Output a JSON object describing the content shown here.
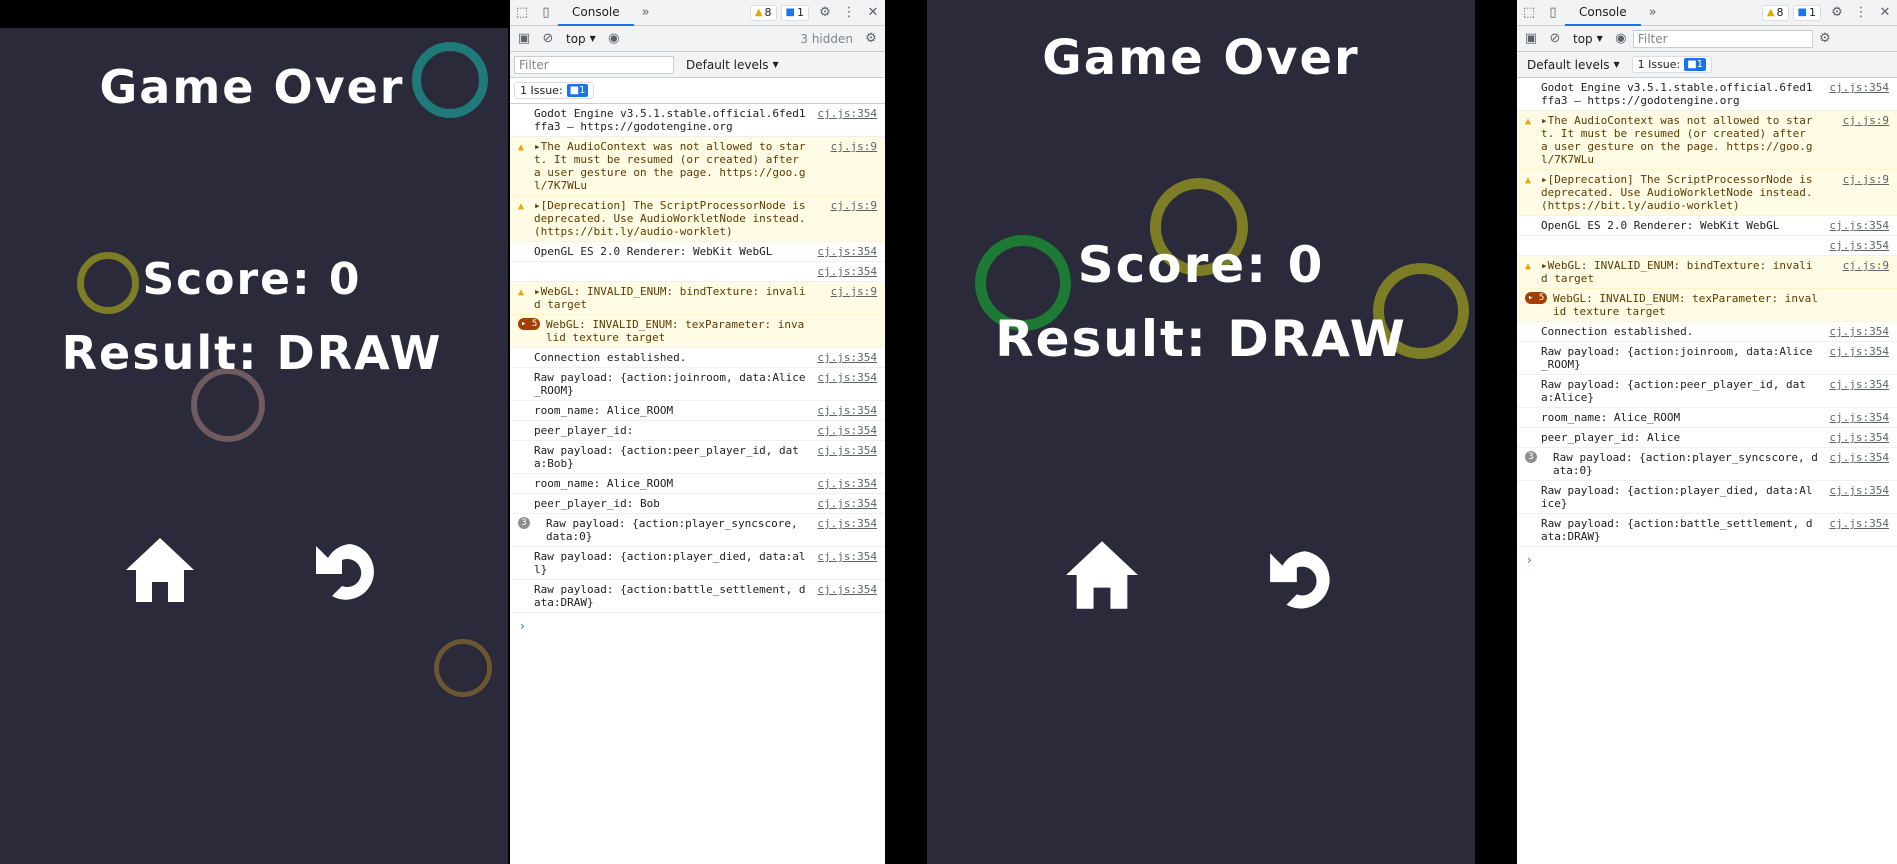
{
  "game_left": {
    "title": "Game Over",
    "score": "Score: 0",
    "result": "Result: DRAW",
    "home_icon": "home-icon",
    "restart_icon": "restart-icon"
  },
  "game_right": {
    "title": "Game Over",
    "score": "Score: 0",
    "result": "Result: DRAW",
    "home_icon": "home-icon",
    "restart_icon": "restart-icon"
  },
  "colors": {
    "game_bg": "#2b2a3a",
    "ring_teal": "#1f7a7a",
    "ring_olive": "#7c7d24",
    "ring_green": "#1c7a34",
    "ring_mauve": "#6e5a5f",
    "ring_brown": "#6b5532"
  },
  "devtools_left": {
    "tab": "Console",
    "warnings": "8",
    "messages": "1",
    "context": "top",
    "hidden": "3 hidden",
    "filter_placeholder": "Filter",
    "levels": "Default levels",
    "issues": "1 Issue:",
    "issue_count": "1",
    "logs": [
      {
        "text": "Godot Engine v3.5.1.stable.official.6fed1ffa3 – https://godotengine.org",
        "src": "cj.js:354",
        "level": "info"
      },
      {
        "text": "▸The AudioContext was not allowed to start. It must be resumed (or created) after a user gesture on the page. https://goo.gl/7K7WLu",
        "src": "cj.js:9",
        "level": "warn"
      },
      {
        "text": "▸[Deprecation] The ScriptProcessorNode is deprecated. Use AudioWorkletNode instead. (https://bit.ly/audio-worklet)",
        "src": "cj.js:9",
        "level": "warn"
      },
      {
        "text": "OpenGL ES 2.0 Renderer: WebKit WebGL",
        "src": "cj.js:354",
        "level": "info"
      },
      {
        "text": "",
        "src": "cj.js:354",
        "level": "info"
      },
      {
        "text": "▸WebGL: INVALID_ENUM: bindTexture: invalid target",
        "src": "cj.js:9",
        "level": "warn"
      },
      {
        "text": "WebGL: INVALID_ENUM: texParameter: invalid texture target",
        "src": "",
        "level": "warn",
        "count": "▸ 5"
      },
      {
        "text": "Connection established.",
        "src": "cj.js:354",
        "level": "info"
      },
      {
        "text": "Raw payload: {action:joinroom, data:Alice_ROOM}",
        "src": "cj.js:354",
        "level": "info"
      },
      {
        "text": "room_name: Alice_ROOM",
        "src": "cj.js:354",
        "level": "info"
      },
      {
        "text": "peer_player_id:",
        "src": "cj.js:354",
        "level": "info"
      },
      {
        "text": "Raw payload: {action:peer_player_id, data:Bob}",
        "src": "cj.js:354",
        "level": "info"
      },
      {
        "text": "room_name: Alice_ROOM",
        "src": "cj.js:354",
        "level": "info"
      },
      {
        "text": "peer_player_id: Bob",
        "src": "cj.js:354",
        "level": "info"
      },
      {
        "text": "Raw payload: {action:player_syncscore, data:0}",
        "src": "cj.js:354",
        "level": "info",
        "count": "3"
      },
      {
        "text": "Raw payload: {action:player_died, data:all}",
        "src": "cj.js:354",
        "level": "info"
      },
      {
        "text": "Raw payload: {action:battle_settlement, data:DRAW}",
        "src": "cj.js:354",
        "level": "info"
      }
    ],
    "prompt": "›"
  },
  "devtools_right": {
    "tab": "Console",
    "warnings": "8",
    "messages": "1",
    "context": "top",
    "filter_placeholder": "Filter",
    "levels": "Default levels",
    "issues": "1 Issue:",
    "issue_count": "1",
    "logs": [
      {
        "text": "Godot Engine v3.5.1.stable.official.6fed1ffa3 – https://godotengine.org",
        "src": "cj.js:354",
        "level": "info"
      },
      {
        "text": "▸The AudioContext was not allowed to start. It must be resumed (or created) after a user gesture on the page. https://goo.gl/7K7WLu",
        "src": "cj.js:9",
        "level": "warn"
      },
      {
        "text": "▸[Deprecation] The ScriptProcessorNode is deprecated. Use AudioWorkletNode instead. (https://bit.ly/audio-worklet)",
        "src": "cj.js:9",
        "level": "warn"
      },
      {
        "text": "OpenGL ES 2.0 Renderer: WebKit WebGL",
        "src": "cj.js:354",
        "level": "info"
      },
      {
        "text": "",
        "src": "cj.js:354",
        "level": "info"
      },
      {
        "text": "▸WebGL: INVALID_ENUM: bindTexture: invalid target",
        "src": "cj.js:9",
        "level": "warn"
      },
      {
        "text": "WebGL: INVALID_ENUM: texParameter: invalid texture target",
        "src": "",
        "level": "warn",
        "count": "▸ 5"
      },
      {
        "text": "Connection established.",
        "src": "cj.js:354",
        "level": "info"
      },
      {
        "text": "Raw payload: {action:joinroom, data:Alice_ROOM}",
        "src": "cj.js:354",
        "level": "info"
      },
      {
        "text": "Raw payload: {action:peer_player_id, data:Alice}",
        "src": "cj.js:354",
        "level": "info"
      },
      {
        "text": "room_name: Alice_ROOM",
        "src": "cj.js:354",
        "level": "info"
      },
      {
        "text": "peer_player_id: Alice",
        "src": "cj.js:354",
        "level": "info"
      },
      {
        "text": "Raw payload: {action:player_syncscore, data:0}",
        "src": "cj.js:354",
        "level": "info",
        "count": "3"
      },
      {
        "text": "Raw payload: {action:player_died, data:Alice}",
        "src": "cj.js:354",
        "level": "info"
      },
      {
        "text": "Raw payload: {action:battle_settlement, data:DRAW}",
        "src": "cj.js:354",
        "level": "info"
      }
    ],
    "prompt": "›"
  }
}
